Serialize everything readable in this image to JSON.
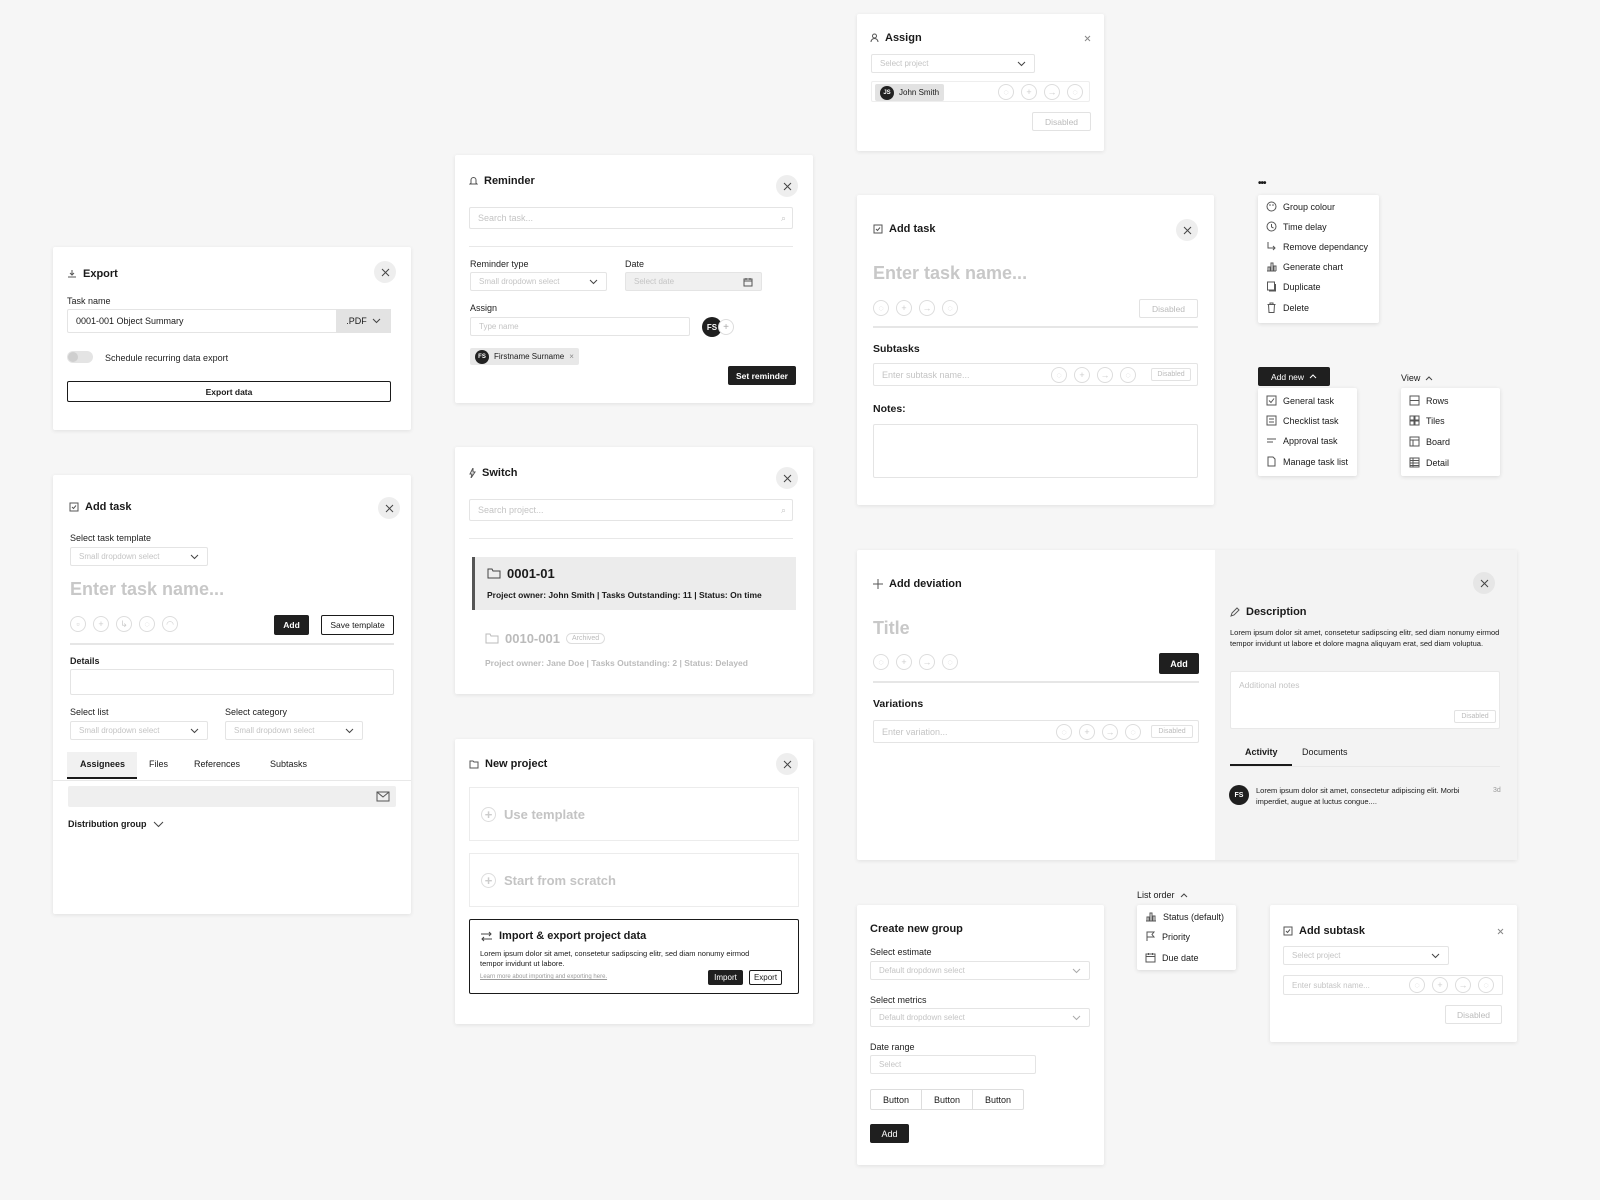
{
  "export": {
    "title": "Export",
    "task_name_label": "Task name",
    "task_name_value": "0001-001 Object Summary",
    "format": ".PDF",
    "schedule_label": "Schedule recurring data export",
    "export_button": "Export data"
  },
  "add_task_left": {
    "title": "Add task",
    "template_label": "Select task template",
    "template_placeholder": "Small dropdown select",
    "name_placeholder": "Enter task name...",
    "add_button": "Add",
    "save_template_button": "Save template",
    "details_label": "Details",
    "list_label": "Select list",
    "list_placeholder": "Small dropdown select",
    "category_label": "Select category",
    "category_placeholder": "Small dropdown select",
    "tabs": [
      {
        "label": "Assignees"
      },
      {
        "label": "Files"
      },
      {
        "label": "References"
      },
      {
        "label": "Subtasks"
      }
    ],
    "distribution_label": "Distribution group"
  },
  "reminder": {
    "title": "Reminder",
    "search_placeholder": "Search task...",
    "type_label": "Reminder type",
    "type_placeholder": "Small dropdown select",
    "date_label": "Date",
    "date_placeholder": "Select date",
    "assign_label": "Assign",
    "assign_placeholder": "Type name",
    "avatar_initials": "FS",
    "chip_name": "Firstname Surname",
    "set_button": "Set reminder"
  },
  "switch": {
    "title": "Switch",
    "search_placeholder": "Search project...",
    "projects": [
      {
        "code": "0001-01",
        "meta": "Project owner: John Smith | Tasks Outstanding: 11 | Status: On time"
      },
      {
        "code": "0010-001",
        "badge": "Archived",
        "meta": "Project owner: Jane Doe | Tasks Outstanding: 2 | Status: Delayed"
      }
    ]
  },
  "new_project": {
    "title": "New project",
    "use_template": "Use template",
    "from_scratch": "Start from scratch",
    "import_title": "Import & export project data",
    "import_text": "Lorem ipsum dolor sit amet, consetetur sadipscing elitr, sed diam nonumy eirmod tempor invidunt ut labore.",
    "import_link": "Learn more about importing and exporting here.",
    "import_button": "Import",
    "export_button": "Export"
  },
  "assign": {
    "title": "Assign",
    "project_placeholder": "Select project",
    "chip_initials": "JS",
    "chip_name": "John Smith",
    "disabled_button": "Disabled"
  },
  "add_task_mid": {
    "title": "Add task",
    "name_placeholder": "Enter task name...",
    "disabled_button": "Disabled",
    "subtasks_label": "Subtasks",
    "subtask_placeholder": "Enter subtask name...",
    "subtask_disabled": "Disabled",
    "notes_label": "Notes:"
  },
  "more_menu": {
    "dots": "•••",
    "items": [
      {
        "label": "Group colour"
      },
      {
        "label": "Time delay"
      },
      {
        "label": "Remove dependancy"
      },
      {
        "label": "Generate chart"
      },
      {
        "label": "Duplicate"
      },
      {
        "label": "Delete"
      }
    ]
  },
  "add_new": {
    "button": "Add new",
    "items": [
      {
        "label": "General task"
      },
      {
        "label": "Checklist task"
      },
      {
        "label": "Approval task"
      },
      {
        "label": "Manage task list"
      }
    ]
  },
  "view_menu": {
    "label": "View",
    "items": [
      {
        "label": "Rows"
      },
      {
        "label": "Tiles"
      },
      {
        "label": "Board"
      },
      {
        "label": "Detail"
      }
    ]
  },
  "deviation": {
    "title": "Add deviation",
    "title_placeholder": "Title",
    "add_button": "Add",
    "variations_label": "Variations",
    "variation_placeholder": "Enter variation...",
    "variation_disabled": "Disabled",
    "desc_title": "Description",
    "desc_text": "Lorem ipsum dolor sit amet, consetetur sadipscing elitr, sed diam nonumy eirmod tempor invidunt ut labore et dolore magna aliquyam erat, sed diam voluptua.",
    "notes_placeholder": "Additional notes",
    "notes_disabled": "Disabled",
    "tabs": [
      {
        "label": "Activity"
      },
      {
        "label": "Documents"
      }
    ],
    "activity": {
      "initials": "FS",
      "text": "Lorem ipsum dolor sit amet, consectetur adipiscing elit. Morbi imperdiet, augue at luctus congue....",
      "time": "3d"
    }
  },
  "create_group": {
    "title": "Create new group",
    "estimate_label": "Select estimate",
    "estimate_placeholder": "Default dropdown select",
    "metrics_label": "Select metrics",
    "metrics_placeholder": "Default dropdown select",
    "date_label": "Date range",
    "date_placeholder": "Select",
    "buttons": [
      {
        "label": "Button"
      },
      {
        "label": "Button"
      },
      {
        "label": "Button"
      }
    ],
    "add_button": "Add"
  },
  "list_order": {
    "label": "List order",
    "items": [
      {
        "label": "Status (default)"
      },
      {
        "label": "Priority"
      },
      {
        "label": "Due date"
      }
    ]
  },
  "add_subtask": {
    "title": "Add subtask",
    "project_placeholder": "Select project",
    "subtask_placeholder": "Enter subtask name...",
    "disabled_button": "Disabled"
  },
  "colors": {
    "dark": "#1f1f1f",
    "bg": "#f6f6f6",
    "muted": "#c4c4c4"
  }
}
